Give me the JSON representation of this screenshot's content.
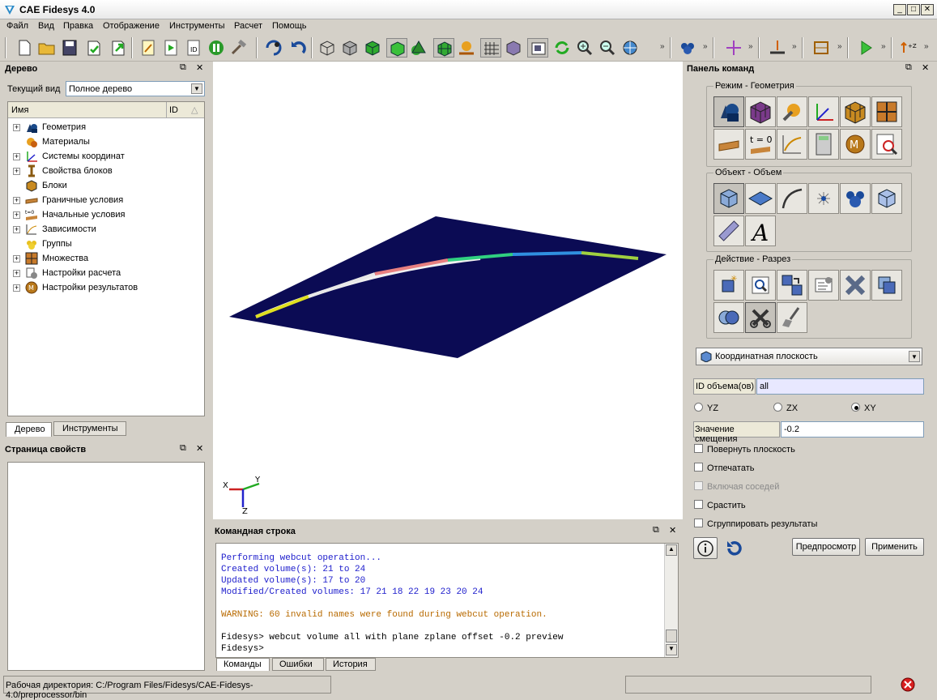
{
  "window": {
    "title": "CAE Fidesys 4.0"
  },
  "menu": [
    "Файл",
    "Вид",
    "Правка",
    "Отображение",
    "Инструменты",
    "Расчет",
    "Помощь"
  ],
  "tree_panel": {
    "title": "Дерево",
    "current_view_label": "Текущий вид",
    "current_view_value": "Полное дерево",
    "col_name": "Имя",
    "col_id": "ID",
    "items": [
      {
        "label": "Геометрия",
        "icon": "geometry-icon",
        "expandable": true
      },
      {
        "label": "Материалы",
        "icon": "materials-icon",
        "expandable": false
      },
      {
        "label": "Системы координат",
        "icon": "coordinate-systems-icon",
        "expandable": true
      },
      {
        "label": "Свойства блоков",
        "icon": "block-properties-icon",
        "expandable": true
      },
      {
        "label": "Блоки",
        "icon": "blocks-icon",
        "expandable": false
      },
      {
        "label": "Граничные условия",
        "icon": "boundary-conditions-icon",
        "expandable": true
      },
      {
        "label": "Начальные условия",
        "icon": "initial-conditions-icon",
        "expandable": true
      },
      {
        "label": "Зависимости",
        "icon": "dependencies-icon",
        "expandable": true
      },
      {
        "label": "Группы",
        "icon": "groups-icon",
        "expandable": false
      },
      {
        "label": "Множества",
        "icon": "sets-icon",
        "expandable": true
      },
      {
        "label": "Настройки расчета",
        "icon": "calc-settings-icon",
        "expandable": true
      },
      {
        "label": "Настройки результатов",
        "icon": "results-settings-icon",
        "expandable": true
      }
    ],
    "tabs": [
      "Дерево",
      "Инструменты"
    ]
  },
  "properties_panel": {
    "title": "Страница свойств"
  },
  "triad": {
    "x": "X",
    "y": "Y",
    "z": "Z"
  },
  "command_line": {
    "title": "Командная строка",
    "lines": [
      {
        "text": "Performing webcut operation...",
        "color": "#1c1ccc"
      },
      {
        "text": "Created volume(s): 21 to 24",
        "color": "#1c1ccc"
      },
      {
        "text": "Updated volume(s): 17 to 20",
        "color": "#1c1ccc"
      },
      {
        "text": "Modified/Created volumes: 17 21 18 22 19 23 20 24",
        "color": "#1c1ccc"
      },
      {
        "text": "",
        "color": "#000000"
      },
      {
        "text": "WARNING: 60 invalid names were found during webcut operation.",
        "color": "#b86a00"
      },
      {
        "text": "",
        "color": "#000000"
      },
      {
        "text": "Fidesys> webcut volume all with plane zplane offset -0.2 preview",
        "color": "#000000"
      },
      {
        "text": "Fidesys>",
        "color": "#000000"
      }
    ],
    "tabs": [
      "Команды",
      "Ошибки",
      "История"
    ]
  },
  "command_panel": {
    "title": "Панель команд",
    "group_mode": "Режим - Геометрия",
    "group_object": "Объект - Объем",
    "group_action": "Действие - Разрез",
    "mode_time_label": "t = 0",
    "dropdown_value": "Координатная плоскость",
    "volume_id_label": "ID объема(ов)",
    "volume_id_value": "all",
    "radio_yz": "YZ",
    "radio_zx": "ZX",
    "radio_xy": "XY",
    "offset_label": "Значение смещения",
    "offset_value": "-0.2",
    "check_rotate": "Повернуть плоскость",
    "check_print": "Отпечатать",
    "check_neighbors": "Включая соседей",
    "check_merge": "Срастить",
    "check_group": "Сгруппировать результаты",
    "preview_button": "Предпросмотр",
    "apply_button": "Применить"
  },
  "status": {
    "workdir": "Рабочая директория: C:/Program Files/Fidesys/CAE-Fidesys-4.0/preprocessor/bin"
  }
}
